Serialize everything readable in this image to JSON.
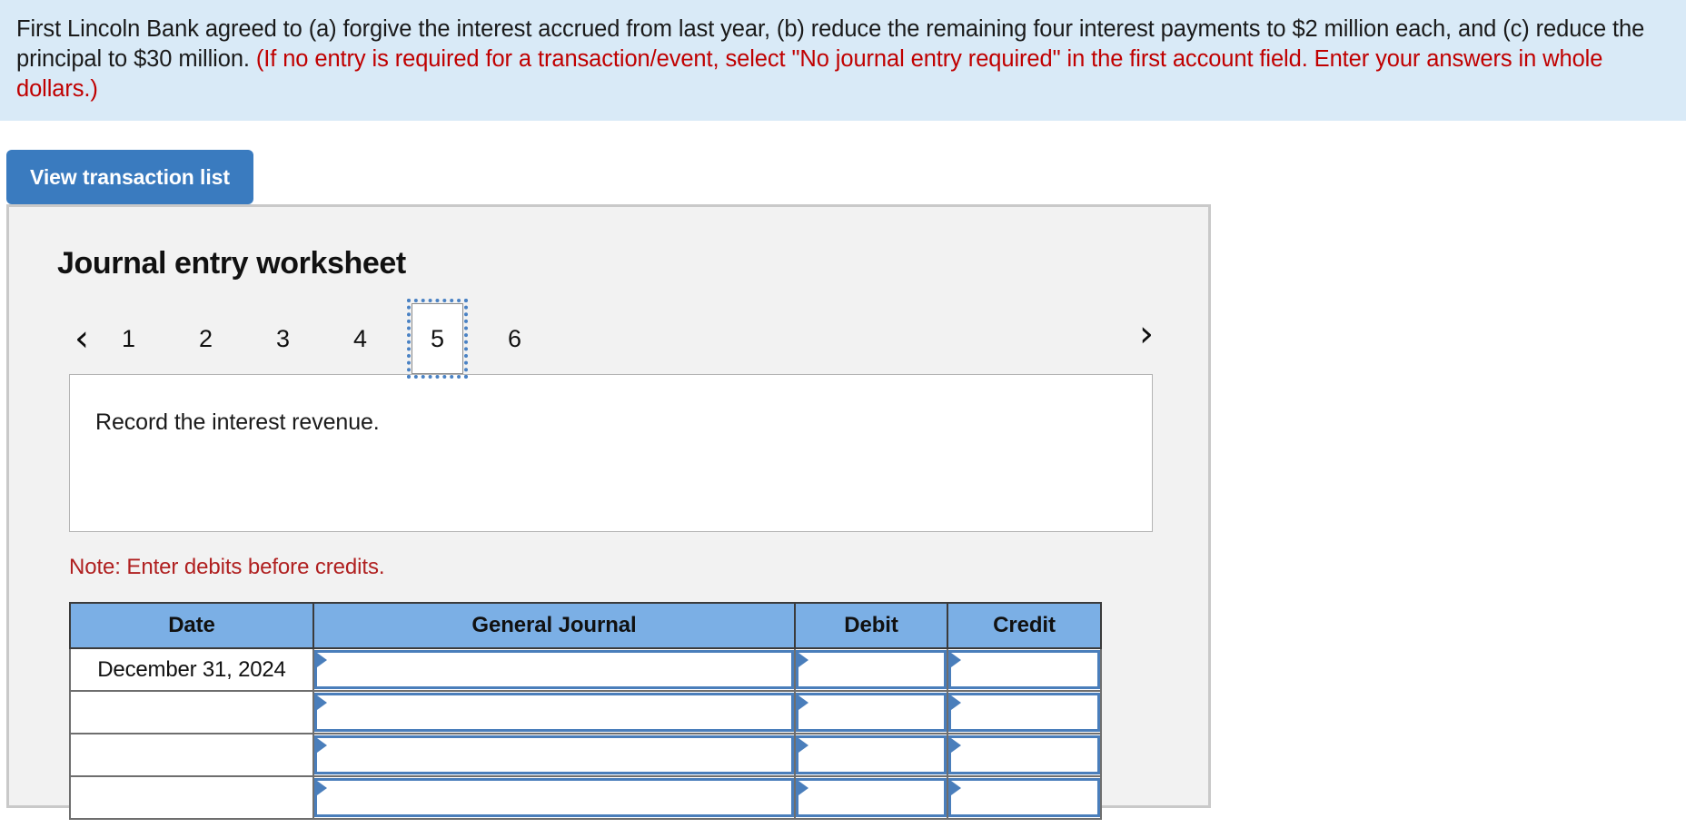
{
  "banner": {
    "text_main_1": "First Lincoln Bank agreed to (a) forgive the interest accrued from last year, (b) reduce the remaining four interest payments to $2 million each, and (c) reduce the principal to $30 million. ",
    "text_required": "(If no entry is required for a transaction/event, select \"No journal entry required\" in the first account field. Enter your answers in whole dollars.)"
  },
  "toolbar": {
    "view_transaction_list_label": "View transaction list"
  },
  "worksheet": {
    "title": "Journal entry worksheet",
    "pager": {
      "prev_icon": "‹",
      "next_icon": "›",
      "pages": [
        "1",
        "2",
        "3",
        "4",
        "5",
        "6"
      ],
      "active_page": "5"
    },
    "transaction_description": "Record the interest revenue.",
    "note": "Note: Enter debits before credits.",
    "table": {
      "headers": [
        "Date",
        "General Journal",
        "Debit",
        "Credit"
      ],
      "rows": [
        {
          "date": "December 31, 2024",
          "general_journal": "",
          "debit": "",
          "credit": ""
        },
        {
          "date": "",
          "general_journal": "",
          "debit": "",
          "credit": ""
        },
        {
          "date": "",
          "general_journal": "",
          "debit": "",
          "credit": ""
        },
        {
          "date": "",
          "general_journal": "",
          "debit": "",
          "credit": ""
        }
      ]
    }
  },
  "colors": {
    "banner_bg": "#d9eaf7",
    "required_text": "#c00000",
    "button_blue": "#3a7bbf",
    "table_header_blue": "#7bafe5",
    "field_border_blue": "#4a7ebb",
    "note_red": "#b02020",
    "card_bg": "#f2f2f2"
  }
}
